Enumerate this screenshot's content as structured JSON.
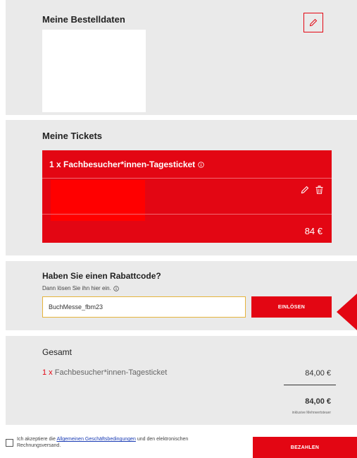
{
  "order": {
    "title": "Meine Bestelldaten",
    "edit_icon": "pencil-icon"
  },
  "tickets": {
    "title": "Meine Tickets",
    "ticket_name": "1 x Fachbesucher*innen-Tagesticket",
    "info_icon": "info-icon",
    "edit_icon": "pencil-icon",
    "delete_icon": "trash-icon",
    "price": "84 €"
  },
  "discount": {
    "title": "Haben Sie einen Rabattcode?",
    "subtitle": "Dann lösen Sie ihn hier ein.",
    "info_icon": "info-icon",
    "code_value": "BuchMesse_fbm23",
    "redeem_label": "EINLÖSEN"
  },
  "total": {
    "title": "Gesamt",
    "line_qty": "1 x",
    "line_item": "Fachbesucher*innen-Tagesticket",
    "line_amount": "84,00 €",
    "grand_total": "84,00 €",
    "vat_note": "inklusive Mehrwertsteuer"
  },
  "footer": {
    "terms_prefix": "Ich akzeptiere die",
    "terms_link": "Allgemeinen Geschäftsbedingungen",
    "terms_suffix": "und den elektronischen Rechnungsversand.",
    "pay_label": "BEZAHLEN"
  },
  "colors": {
    "accent": "#e30613",
    "panel_bg": "#eaeaea"
  }
}
